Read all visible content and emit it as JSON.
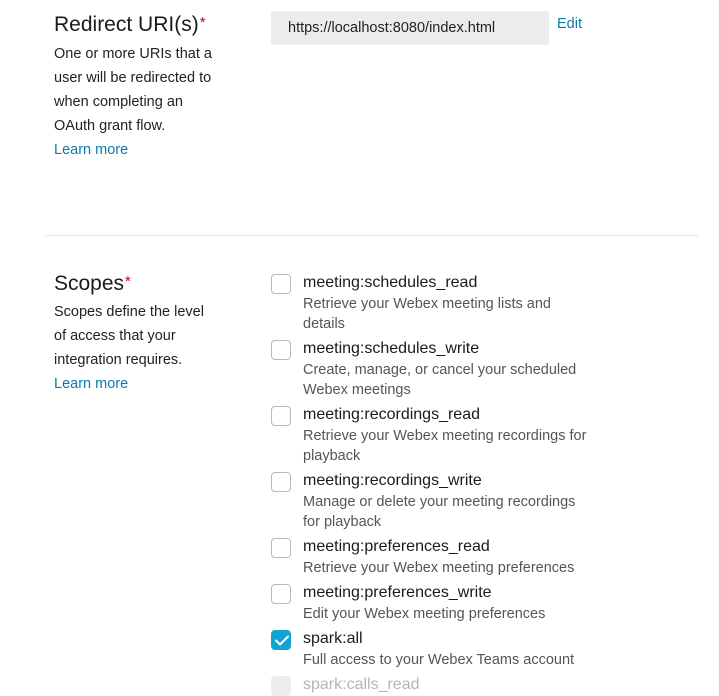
{
  "redirect": {
    "title": "Redirect URI(s)",
    "required_mark": "*",
    "description": "One or more URIs that a user will be redirected to when completing an OAuth grant flow.",
    "learn_more": "Learn more",
    "uri_value": "https://localhost:8080/index.html",
    "edit_label": "Edit"
  },
  "scopes": {
    "title": "Scopes",
    "required_mark": "*",
    "description": "Scopes define the level of access that your integration requires.",
    "learn_more": "Learn more",
    "items": [
      {
        "name": "meeting:schedules_read",
        "description": "Retrieve your Webex meeting lists and details",
        "checked": false
      },
      {
        "name": "meeting:schedules_write",
        "description": "Create, manage, or cancel your scheduled Webex meetings",
        "checked": false
      },
      {
        "name": "meeting:recordings_read",
        "description": "Retrieve your Webex meeting recordings for playback",
        "checked": false
      },
      {
        "name": "meeting:recordings_write",
        "description": "Manage or delete your meeting recordings for playback",
        "checked": false
      },
      {
        "name": "meeting:preferences_read",
        "description": "Retrieve your Webex meeting preferences",
        "checked": false
      },
      {
        "name": "meeting:preferences_write",
        "description": "Edit your Webex meeting preferences",
        "checked": false
      },
      {
        "name": "spark:all",
        "description": "Full access to your Webex Teams account",
        "checked": true
      },
      {
        "name": "spark:calls_read",
        "description": "",
        "checked": false,
        "disabled": true
      }
    ]
  },
  "colors": {
    "accent": "#0a7bab",
    "checkbox_checked": "#12a3d4",
    "required": "#d0021b"
  }
}
